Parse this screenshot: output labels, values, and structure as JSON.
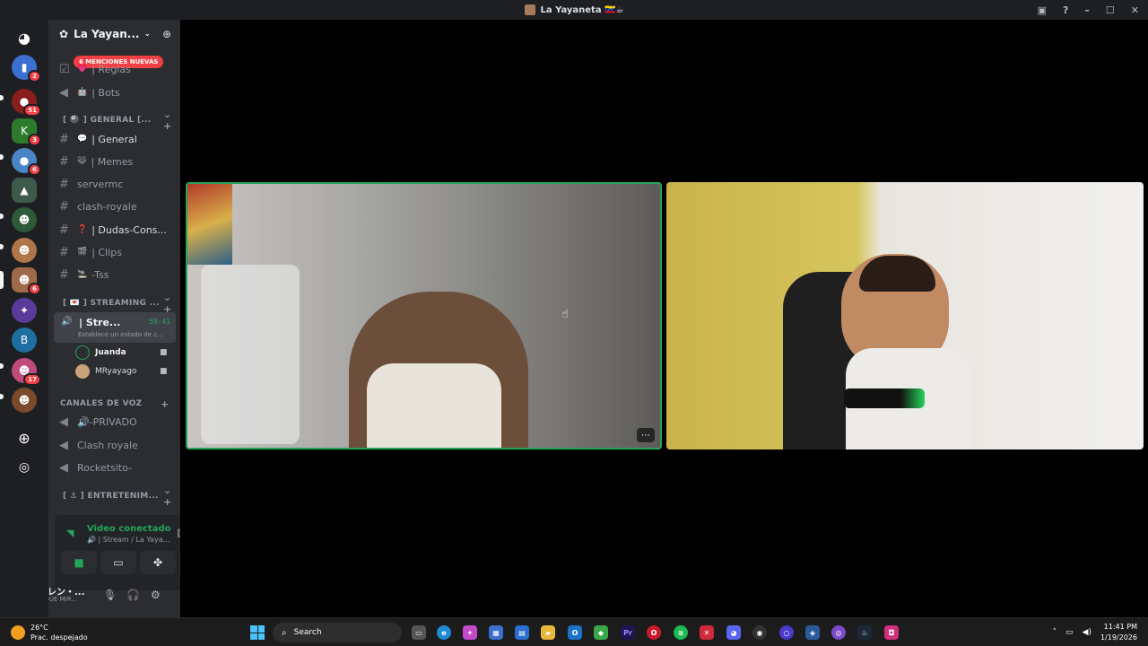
{
  "window": {
    "title": "La Yayaneta 🇻🇪☕",
    "controls": [
      "inbox",
      "help",
      "minimize",
      "maximize",
      "close"
    ]
  },
  "server_rail": {
    "items": [
      {
        "name": "home",
        "badge": ""
      },
      {
        "name": "server-1",
        "badge": "2"
      },
      {
        "name": "server-2",
        "badge": "51"
      },
      {
        "name": "server-3",
        "badge": "3"
      },
      {
        "name": "server-4",
        "badge": "6"
      },
      {
        "name": "server-5",
        "badge": ""
      },
      {
        "name": "server-6",
        "badge": ""
      },
      {
        "name": "server-7",
        "badge": ""
      },
      {
        "name": "server-8",
        "badge": "6"
      },
      {
        "name": "server-9",
        "badge": ""
      },
      {
        "name": "server-10",
        "badge": ""
      },
      {
        "name": "server-11",
        "badge": "17"
      },
      {
        "name": "server-12",
        "badge": ""
      }
    ]
  },
  "guild": {
    "name": "La Yayan...",
    "mentions_banner": "6 MENCIONES NUEVAS"
  },
  "channels": {
    "top": [
      {
        "name": "| Reglas",
        "icon": "💗"
      },
      {
        "name": "| Bots",
        "icon": "🤖"
      }
    ],
    "category_general": "[ 🎱 ] GENERAL [...",
    "general_items": [
      {
        "name": "| General",
        "icon": "💬"
      },
      {
        "name": "| Memes",
        "icon": "😹"
      },
      {
        "name": "servermc",
        "icon": ""
      },
      {
        "name": "clash-royale",
        "icon": ""
      },
      {
        "name": "| Dudas-Cons...",
        "icon": "❓"
      },
      {
        "name": "| Clips",
        "icon": "🎬"
      },
      {
        "name": "-Tss",
        "icon": "🚬"
      }
    ],
    "category_streaming": "[ 💌 ] STREAMING ...",
    "active_voice": {
      "name": "| Stre...",
      "time": "59:41",
      "status": "Establece un estado de c..."
    },
    "voice_users": [
      {
        "name": "Juanda",
        "bold": true
      },
      {
        "name": "MRyayago",
        "bold": false
      }
    ],
    "category_voz": "CANALES DE VOZ",
    "voz_items": [
      {
        "name": "🔊-PRIVADO"
      },
      {
        "name": "Clash royale"
      },
      {
        "name": "Rocketsito-"
      }
    ],
    "category_entretenimiento": "[ ⚓ ] ENTRETENIM..."
  },
  "voice_panel": {
    "status": "Video conectado",
    "channel": "🔊 | Stream / La Yaya..."
  },
  "user": {
    "name": "エレン・...",
    "status": "• QUE MIR..."
  },
  "taskbar": {
    "weather_temp": "26°C",
    "weather_desc": "Prac. despejado",
    "search_placeholder": "Search",
    "time": "11:41 PM",
    "date": "1/19/2026"
  }
}
